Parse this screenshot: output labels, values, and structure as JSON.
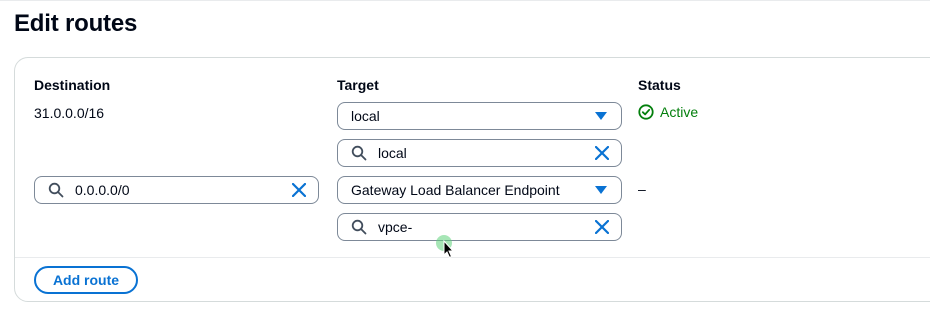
{
  "page": {
    "title": "Edit routes"
  },
  "columns": {
    "destination": "Destination",
    "target": "Target",
    "status": "Status"
  },
  "routes": [
    {
      "destination": "31.0.0.0/16",
      "target": {
        "selected": "local",
        "filter": "local"
      },
      "status": "Active"
    },
    {
      "destination_search": "0.0.0.0/0",
      "target": {
        "selected": "Gateway Load Balancer Endpoint",
        "filter": "vpce-"
      },
      "status": "–"
    }
  ],
  "actions": {
    "add_route": "Add route"
  },
  "colors": {
    "accent": "#0972d3",
    "success": "#037f0c",
    "border": "#7d8998"
  },
  "icons": [
    "search-icon",
    "clear-icon",
    "caret-down-icon",
    "status-positive-icon",
    "cursor-icon"
  ]
}
